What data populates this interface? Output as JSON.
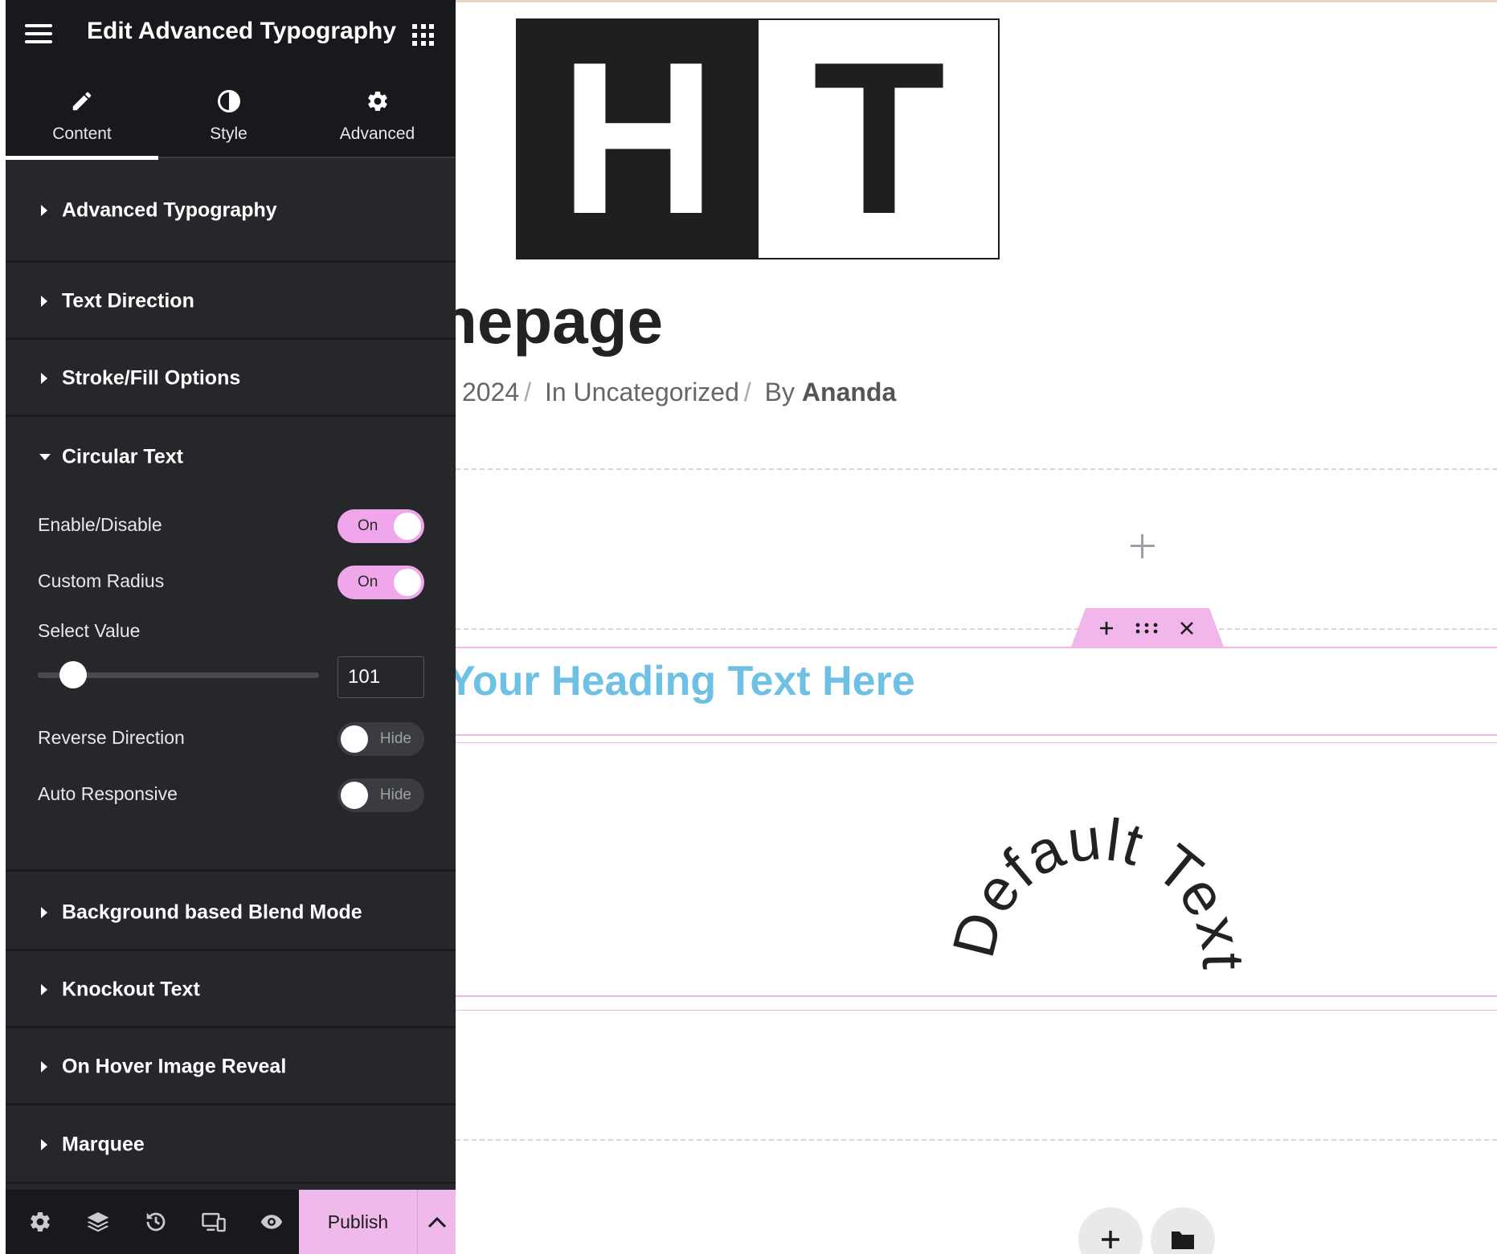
{
  "panel": {
    "title": "Edit Advanced Typography",
    "tabs": [
      {
        "label": "Content",
        "icon": "pencil-icon",
        "active": true
      },
      {
        "label": "Style",
        "icon": "contrast-icon",
        "active": false
      },
      {
        "label": "Advanced",
        "icon": "gear-icon",
        "active": false
      }
    ],
    "sections_top": [
      {
        "label": "Advanced Typography",
        "expanded": false
      },
      {
        "label": "Text Direction",
        "expanded": false
      },
      {
        "label": "Stroke/Fill Options",
        "expanded": false
      },
      {
        "label": "Circular Text",
        "expanded": true
      }
    ],
    "circular_text": {
      "enable_label": "Enable/Disable",
      "enable_state": "On",
      "radius_label": "Custom Radius",
      "radius_state": "On",
      "select_label": "Select Value",
      "select_value": "101",
      "slider_fraction": 0.125,
      "reverse_label": "Reverse Direction",
      "reverse_state": "Hide",
      "auto_label": "Auto Responsive",
      "auto_state": "Hide"
    },
    "sections_bottom": [
      {
        "label": "Background based Blend Mode",
        "expanded": false
      },
      {
        "label": "Knockout Text",
        "expanded": false
      },
      {
        "label": "On Hover Image Reveal",
        "expanded": false
      },
      {
        "label": "Marquee",
        "expanded": false
      }
    ],
    "footer": {
      "icons": [
        "gear-icon",
        "layers-icon",
        "history-icon",
        "responsive-icon",
        "eye-icon"
      ],
      "publish_label": "Publish"
    }
  },
  "canvas": {
    "logo_left": "H",
    "logo_right": "T",
    "page_title": "nepage",
    "meta_date": "2024",
    "meta_category": "In Uncategorized",
    "meta_by": "By",
    "meta_author": "Ananda",
    "heading": "Your Heading Text Here",
    "circular_text": "Default Text"
  },
  "colors": {
    "panel_bg": "#26272b",
    "header_bg": "#18191c",
    "accent_pink": "#f0a6ea",
    "heading_blue": "#6ec1e4"
  }
}
